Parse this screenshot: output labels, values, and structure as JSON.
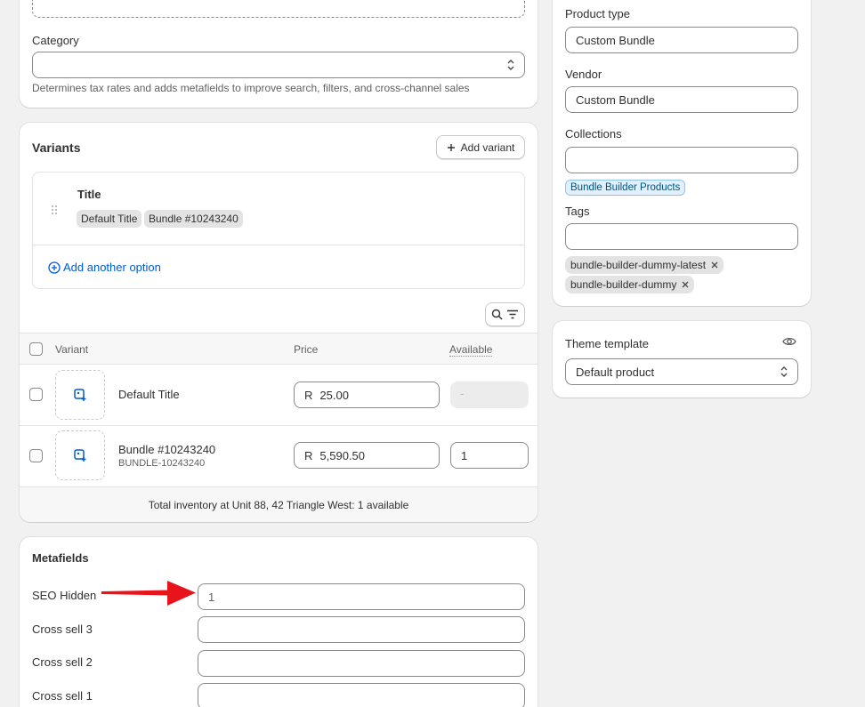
{
  "left": {
    "category": {
      "label": "Category",
      "value": "",
      "help": "Determines tax rates and adds metafields to improve search, filters, and cross-channel sales"
    },
    "variants": {
      "title": "Variants",
      "add_variant_label": "Add variant",
      "option": {
        "name": "Title",
        "values": [
          "Default Title",
          "Bundle #10243240"
        ]
      },
      "add_another_option": "Add another option",
      "table": {
        "headers": {
          "variant": "Variant",
          "price": "Price",
          "available": "Available"
        },
        "rows": [
          {
            "name": "Default Title",
            "sku": "",
            "currency": "R",
            "price": "25.00",
            "available": "-"
          },
          {
            "name": "Bundle #10243240",
            "sku": "BUNDLE-10243240",
            "currency": "R",
            "price": "5,590.50",
            "available": "1"
          }
        ],
        "footer": "Total inventory at Unit 88, 42 Triangle West: 1 available"
      }
    },
    "metafields": {
      "title": "Metafields",
      "fields": [
        {
          "label": "SEO Hidden",
          "value": "1"
        },
        {
          "label": "Cross sell 3",
          "value": ""
        },
        {
          "label": "Cross sell 2",
          "value": ""
        },
        {
          "label": "Cross sell 1",
          "value": ""
        }
      ]
    }
  },
  "right": {
    "organization": {
      "product_type": {
        "label": "Product type",
        "value": "Custom Bundle"
      },
      "vendor": {
        "label": "Vendor",
        "value": "Custom Bundle"
      },
      "collections": {
        "label": "Collections",
        "value": "",
        "chips": [
          "Bundle Builder Products"
        ]
      },
      "tags": {
        "label": "Tags",
        "value": "",
        "chips": [
          "bundle-builder-dummy-latest",
          "bundle-builder-dummy"
        ]
      }
    },
    "theme_template": {
      "label": "Theme template",
      "value": "Default product"
    }
  },
  "colors": {
    "link": "#005bd3",
    "annotation_arrow": "#e8141c",
    "collection_chip_bg": "#e0f0ff",
    "collection_chip_border": "#90c3ee"
  },
  "icons": [
    "plus-icon",
    "drag-handle-icon",
    "plus-circle-icon",
    "search-icon",
    "filter-icon",
    "add-image-icon",
    "select-caret-icon",
    "eye-icon",
    "close-icon"
  ]
}
